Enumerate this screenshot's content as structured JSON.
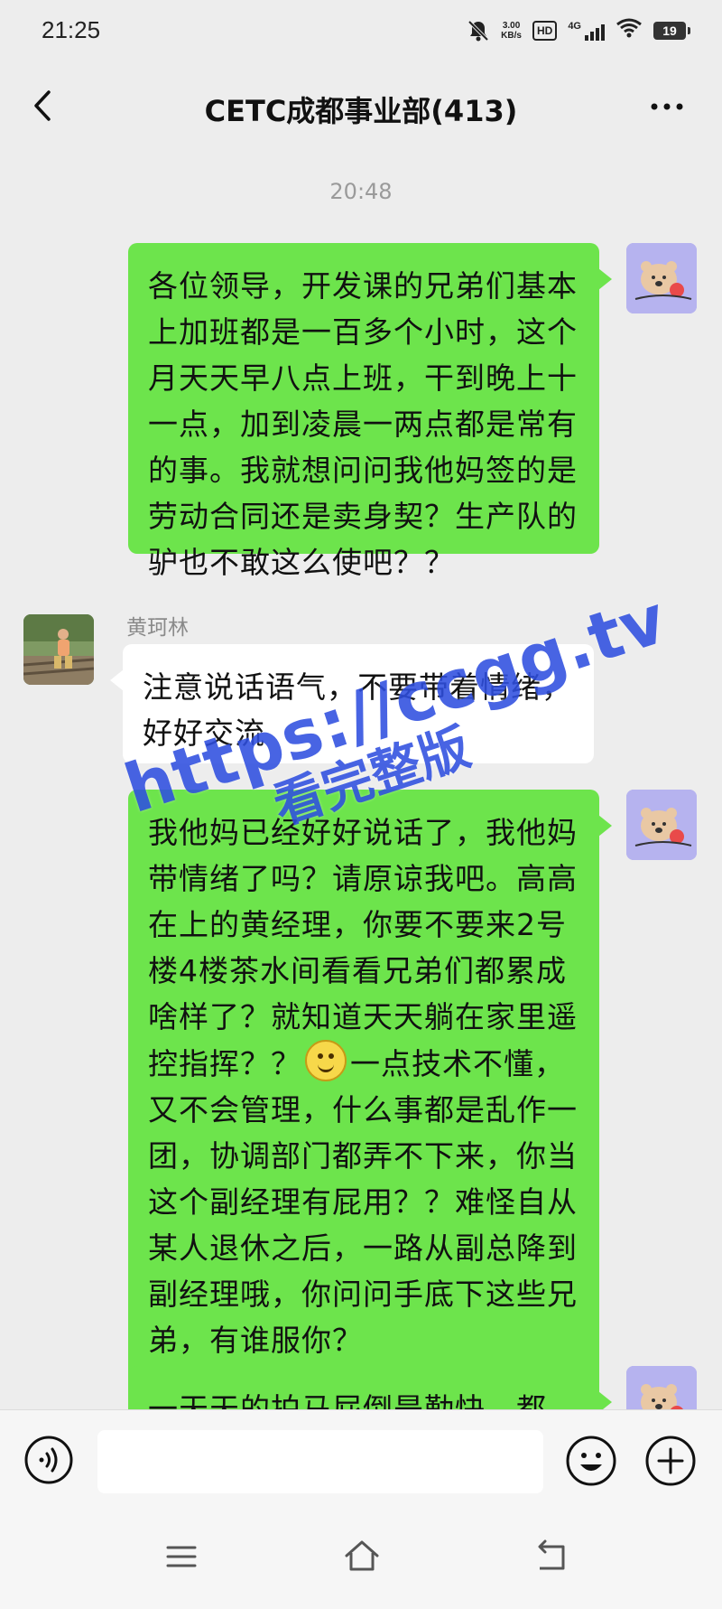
{
  "status_bar": {
    "time": "21:25",
    "net_speed_value": "3.00",
    "net_speed_unit": "KB/s",
    "hd_label": "HD",
    "signal_label": "4G",
    "battery_level": "19",
    "icons": [
      "mute-icon",
      "hd-icon",
      "signal-icon",
      "wifi-icon",
      "battery-icon"
    ]
  },
  "nav": {
    "title": "CETC成都事业部(413)",
    "back_icon": "chevron-left-icon",
    "more_icon": "more-dots-icon"
  },
  "chat": {
    "timestamp": "20:48",
    "messages": [
      {
        "from": "me",
        "text": "各位领导，开发课的兄弟们基本上加班都是一百多个小时，这个月天天早八点上班，干到晚上十一点，加到凌晨一两点都是常有的事。我就想问问我他妈签的是劳动合同还是卖身契？生产队的驴也不敢这么使吧？？"
      },
      {
        "from": "other",
        "sender": "黄珂林",
        "text": "注意说话语气，不要带着情绪，好好交流"
      },
      {
        "from": "me",
        "text_before_emoji": "我他妈已经好好说话了，我他妈带情绪了吗？请原谅我吧。高高在上的黄经理，你要不要来2号楼4楼茶水间看看兄弟们都累成啥样了？就知道天天躺在家里遥控指挥？？",
        "emoji": "smile-emoji",
        "text_after_emoji": "一点技术不懂，又不会管理，什么事都是乱作一团，协调部门都弄不下来，你当这个副经理有屁用？？难怪自从某人退休之后，一路从副总降到副经理哦，你问问手底下这些兄弟，有谁服你？"
      },
      {
        "from": "me",
        "text": "一天天的拍马屁倒是勤快，都"
      }
    ]
  },
  "watermark": {
    "url": "https://ccgg.tv",
    "text": "看完整版"
  },
  "input_bar": {
    "value": "",
    "placeholder": "",
    "voice_icon": "voice-icon",
    "emoji_icon": "emoji-icon",
    "add_icon": "plus-circle-icon"
  },
  "system_nav": {
    "icons": [
      "menu-icon",
      "home-icon",
      "back-arrow-icon"
    ]
  },
  "colors": {
    "background": "#ededed",
    "my_bubble": "#6de44c",
    "other_bubble": "#ffffff",
    "watermark": "#2f4fe0"
  }
}
